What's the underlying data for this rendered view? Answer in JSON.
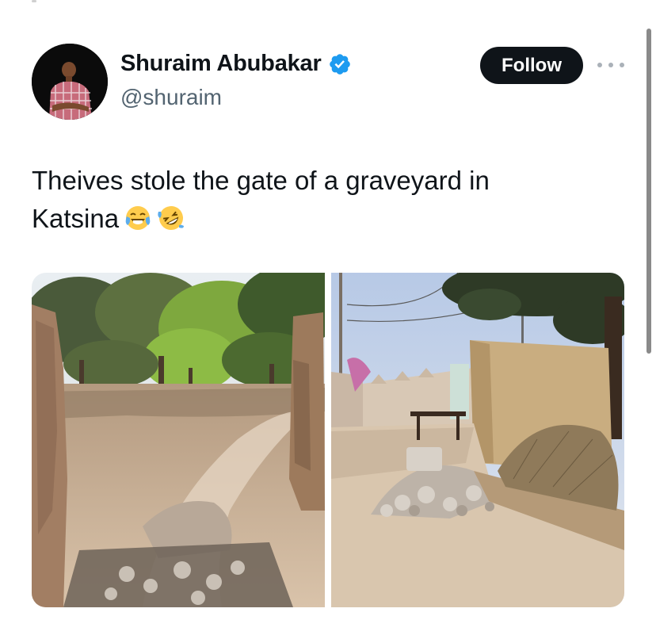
{
  "author": {
    "display_name": "Shuraim Abubakar",
    "handle": "@shuraim",
    "verified": true,
    "avatar_icon": "avatar-person"
  },
  "actions": {
    "follow_label": "Follow",
    "more_icon": "more-horizontal-icon"
  },
  "tweet": {
    "line1": "Theives stole the gate of a graveyard in",
    "line2": "Katsina",
    "emojis": [
      "face-with-tears-of-joy",
      "rolling-on-the-floor-laughing"
    ]
  },
  "media": {
    "photos": [
      {
        "subject": "graveyard entrance with broken wall"
      },
      {
        "subject": "stone rubble by cemetery wall"
      }
    ]
  },
  "colors": {
    "text": "#0f1419",
    "secondary": "#536471",
    "verified_blue": "#1d9bf0",
    "button_bg": "#0f1419"
  }
}
